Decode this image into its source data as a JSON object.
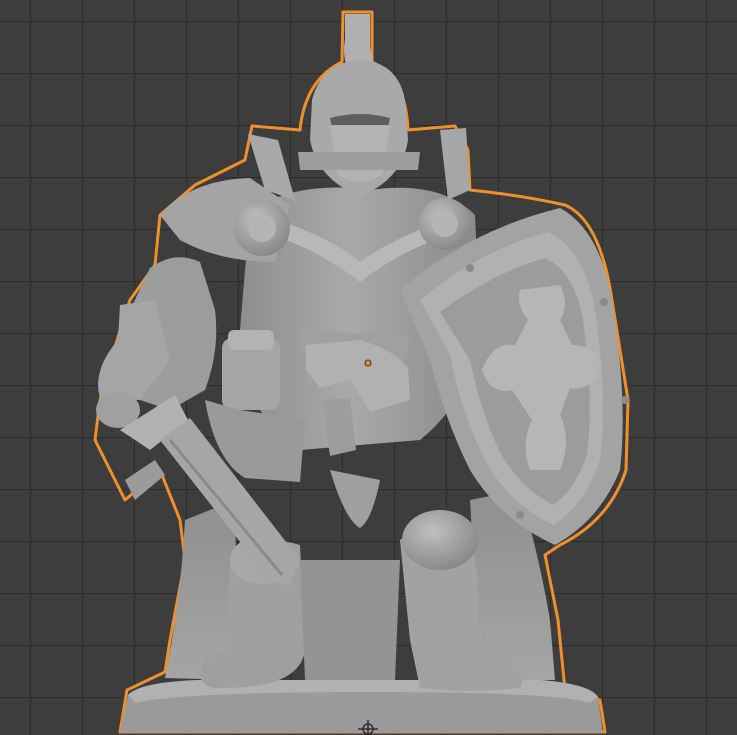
{
  "viewport": {
    "mode": "3d-viewport",
    "background_color": "#3d3d3d",
    "grid_color": "#2c2c2c"
  },
  "scene": {
    "object_name": "",
    "object_selected": true,
    "selection_outline_color": "#f0902a",
    "model_color": "#9c9c9c",
    "model_highlight_color": "#b4b4b4",
    "model_shadow_color": "#707070",
    "origin_marker_color": "#ff8c1a"
  }
}
